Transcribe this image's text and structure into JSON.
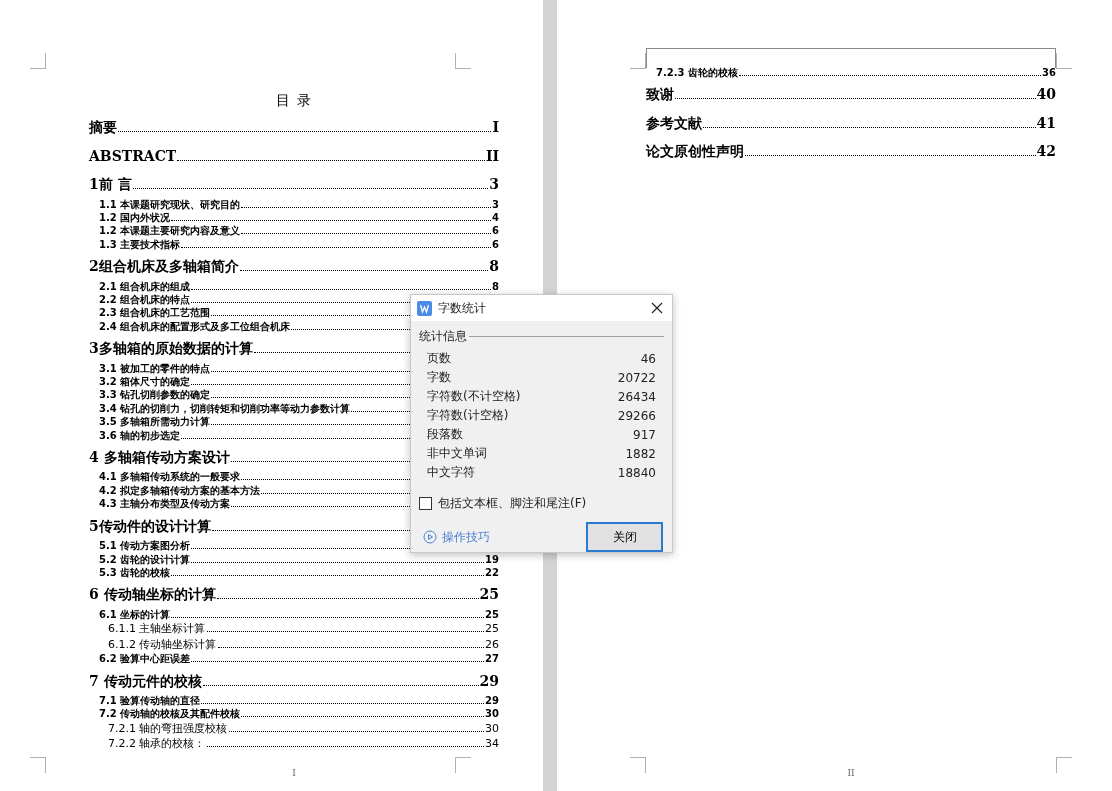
{
  "pages": [
    {
      "footer": "I",
      "title": "目 录",
      "entries": [
        {
          "kind": "h1",
          "title": "摘要",
          "page": "I"
        },
        {
          "kind": "h1",
          "title": "ABSTRACT",
          "page": "II"
        },
        {
          "kind": "h1",
          "title": "1前 言",
          "page": "3"
        },
        {
          "kind": "h2",
          "title": "1.1  本课题研究现状、研究目的",
          "page": "3"
        },
        {
          "kind": "h2",
          "title": "1.2 国内外状况",
          "page": "4"
        },
        {
          "kind": "h2",
          "title": "1.2  本课题主要研究内容及意义",
          "page": "6"
        },
        {
          "kind": "h2",
          "title": "1.3  主要技术指标",
          "page": "6"
        },
        {
          "kind": "h1",
          "title": "2组合机床及多轴箱简介",
          "page": "8"
        },
        {
          "kind": "h2",
          "title": "2.1  组合机床的组成",
          "page": "8"
        },
        {
          "kind": "h2",
          "title": "2.2  组合机床的特点"
        },
        {
          "kind": "h2",
          "title": "2.3  组合机床的工艺范围"
        },
        {
          "kind": "h2",
          "title": "2.4  组合机床的配置形式及多工位组合机床"
        },
        {
          "kind": "h1",
          "title": "3多轴箱的原始数据的计算"
        },
        {
          "kind": "h2",
          "title": "3.1  被加工的零件的特点"
        },
        {
          "kind": "h2",
          "title": "3.2  箱体尺寸的确定"
        },
        {
          "kind": "h2",
          "title": "3.3  钻孔切削参数的确定"
        },
        {
          "kind": "h2",
          "title": "3.4  钻孔的切削力，切削转矩和切削功率等动力参数计算"
        },
        {
          "kind": "h2",
          "title": "3.5  多轴箱所需动力计算"
        },
        {
          "kind": "h2",
          "title": "3.6  轴的初步选定"
        },
        {
          "kind": "h1",
          "title": "4 多轴箱传动方案设计"
        },
        {
          "kind": "h2",
          "title": "4.1  多轴箱传动系统的一般要求"
        },
        {
          "kind": "h2",
          "title": "4.2  拟定多轴箱传动方案的基本方法"
        },
        {
          "kind": "h2",
          "title": "4.3  主轴分布类型及传动方案"
        },
        {
          "kind": "h1",
          "title": "5传动件的设计计算"
        },
        {
          "kind": "h2",
          "title": "5.1  传动方案图分析"
        },
        {
          "kind": "h2",
          "title": "5.2  齿轮的设计计算",
          "page": "19"
        },
        {
          "kind": "h2",
          "title": "5.3  齿轮的校核",
          "page": "22"
        },
        {
          "kind": "h1",
          "title": "6 传动轴坐标的计算",
          "page": "25"
        },
        {
          "kind": "h2",
          "title": "6.1 坐标的计算",
          "page": "25"
        },
        {
          "kind": "h3",
          "title": "6.1.1 主轴坐标计算",
          "page": "25"
        },
        {
          "kind": "h3",
          "title": "6.1.2  传动轴坐标计算",
          "page": "26"
        },
        {
          "kind": "h2",
          "title": "6.2  验算中心距误差",
          "page": "27"
        },
        {
          "kind": "h1",
          "title": "7 传动元件的校核",
          "page": "29"
        },
        {
          "kind": "h2",
          "title": "7.1  验算传动轴的直径",
          "page": "29"
        },
        {
          "kind": "h2",
          "title": "7.2  传动轴的校核及其配件校核",
          "page": "30"
        },
        {
          "kind": "h3",
          "title": "7.2.1  轴的弯扭强度校核",
          "page": "30"
        },
        {
          "kind": "h3",
          "title": "7.2.2  轴承的校核：",
          "page": "34"
        }
      ]
    },
    {
      "footer": "II",
      "entries": [
        {
          "kind": "h2",
          "title": "7.2.3 齿轮的校核",
          "page": "36"
        },
        {
          "kind": "h1",
          "title": "致谢",
          "page": "40"
        },
        {
          "kind": "h1",
          "title": "参考文献",
          "page": "41"
        },
        {
          "kind": "h1",
          "title": "论文原创性声明",
          "page": "42"
        }
      ]
    }
  ],
  "dialog": {
    "title": "字数统计",
    "group": "统计信息",
    "stats": [
      {
        "label": "页数",
        "value": "46"
      },
      {
        "label": "字数",
        "value": "20722"
      },
      {
        "label": "字符数(不计空格)",
        "value": "26434"
      },
      {
        "label": "字符数(计空格)",
        "value": "29266"
      },
      {
        "label": "段落数",
        "value": "917"
      },
      {
        "label": "非中文单词",
        "value": "1882"
      },
      {
        "label": "中文字符",
        "value": "18840"
      }
    ],
    "checkbox": {
      "label": "包括文本框、脚注和尾注(F)",
      "checked": false
    },
    "link": "操作技巧",
    "button": "关闭"
  }
}
